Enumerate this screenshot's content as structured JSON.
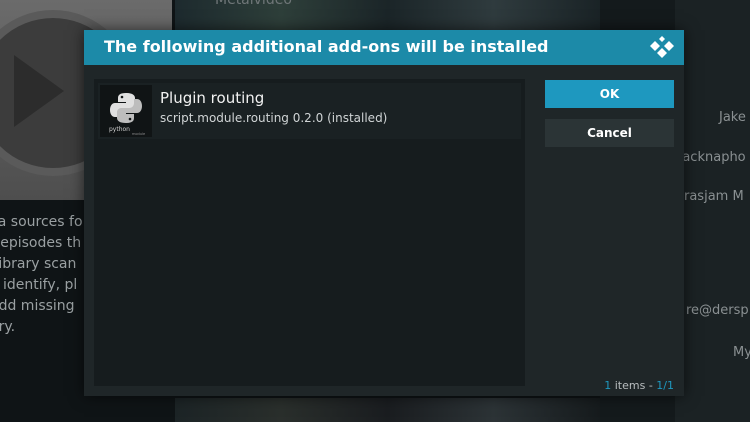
{
  "background": {
    "header_text": "Metalvideo",
    "description_lines": [
      "lia sources fo",
      "r episodes th",
      " library scan",
      "o identify, pl",
      "add missing",
      "ary."
    ],
    "right_names": [
      "Jake",
      "racknapho",
      "rasjam M",
      "re@dersp",
      "My"
    ]
  },
  "dialog": {
    "title": "The following additional add-ons will be installed",
    "logo_icon": "kodi-logo-icon",
    "items": [
      {
        "name": "Plugin routing",
        "description": "script.module.routing 0.2.0 (installed)",
        "thumb_label": "python",
        "thumb_sub": "module"
      }
    ],
    "buttons": {
      "ok": "OK",
      "cancel": "Cancel"
    },
    "footer": {
      "count": "1",
      "items_word": " items - ",
      "page": "1/1"
    }
  },
  "colors": {
    "accent": "#1e98bf",
    "header": "#1c8aa8",
    "dialog_bg": "#1f2628"
  }
}
